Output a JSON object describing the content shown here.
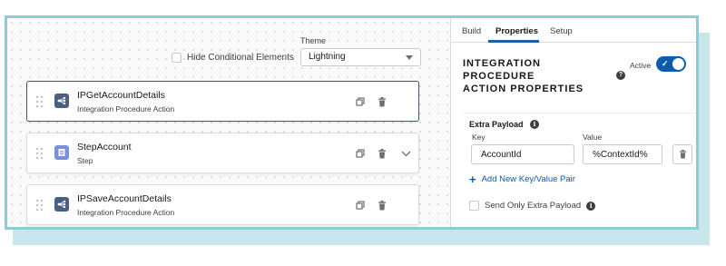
{
  "canvas": {
    "hide_conditional_label": "Hide Conditional Elements",
    "theme_label": "Theme",
    "theme_value": "Lightning",
    "steps": [
      {
        "title": "IPGetAccountDetails",
        "subtitle": "Integration Procedure Action",
        "icon": "integration-procedure-icon",
        "selected": true
      },
      {
        "title": "StepAccount",
        "subtitle": "Step",
        "icon": "step-icon",
        "selected": false
      },
      {
        "title": "IPSaveAccountDetails",
        "subtitle": "Integration Procedure Action",
        "icon": "integration-procedure-icon",
        "selected": false
      }
    ]
  },
  "panel": {
    "tabs": [
      {
        "label": "Build",
        "active": false
      },
      {
        "label": "Properties",
        "active": true
      },
      {
        "label": "Setup",
        "active": false
      }
    ],
    "title_lines": [
      "INTEGRATION",
      "PROCEDURE",
      "ACTION PROPERTIES"
    ],
    "active_label": "Active",
    "active_on": true,
    "extra_payload_label": "Extra Payload",
    "key_col": "Key",
    "value_col": "Value",
    "key_value": "AccountId",
    "value_value": "%ContextId%",
    "add_pair_label": "Add New Key/Value Pair",
    "send_only_label": "Send Only Extra Payload"
  },
  "colors": {
    "brand_blue": "#0b5cab",
    "frame": "#8fcbd6",
    "ip_icon": "#4b5f82",
    "step_icon": "#7b8fd6"
  }
}
